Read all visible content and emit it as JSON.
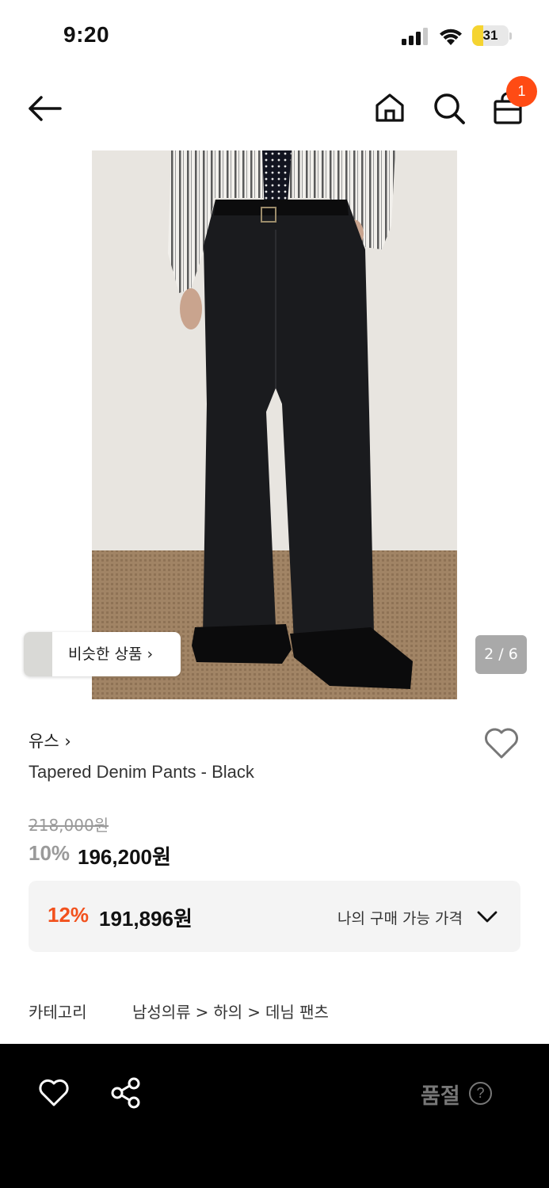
{
  "status_bar": {
    "time": "9:20",
    "battery": "31",
    "battery_level": 0.31
  },
  "header": {
    "cart_count": "1"
  },
  "gallery": {
    "similar_label": "비슷한 상품 ›",
    "counter": "2 / 6"
  },
  "product": {
    "brand": "유스 ›",
    "title": "Tapered Denim Pants - Black",
    "original_price": "218,000원",
    "discount_rate": "10%",
    "sale_price": "196,200원"
  },
  "member_price": {
    "rate": "12%",
    "price": "191,896원",
    "label": "나의 구매 가능 가격"
  },
  "category": {
    "label": "카테고리",
    "path": [
      "남성의류",
      "하의",
      "데님 팬츠"
    ],
    "separator": ">"
  },
  "bottom_bar": {
    "status": "품절",
    "help": "?"
  },
  "colors": {
    "badge": "#ff4b14",
    "accent": "#f2511d",
    "bottom_bar": "#000000"
  }
}
